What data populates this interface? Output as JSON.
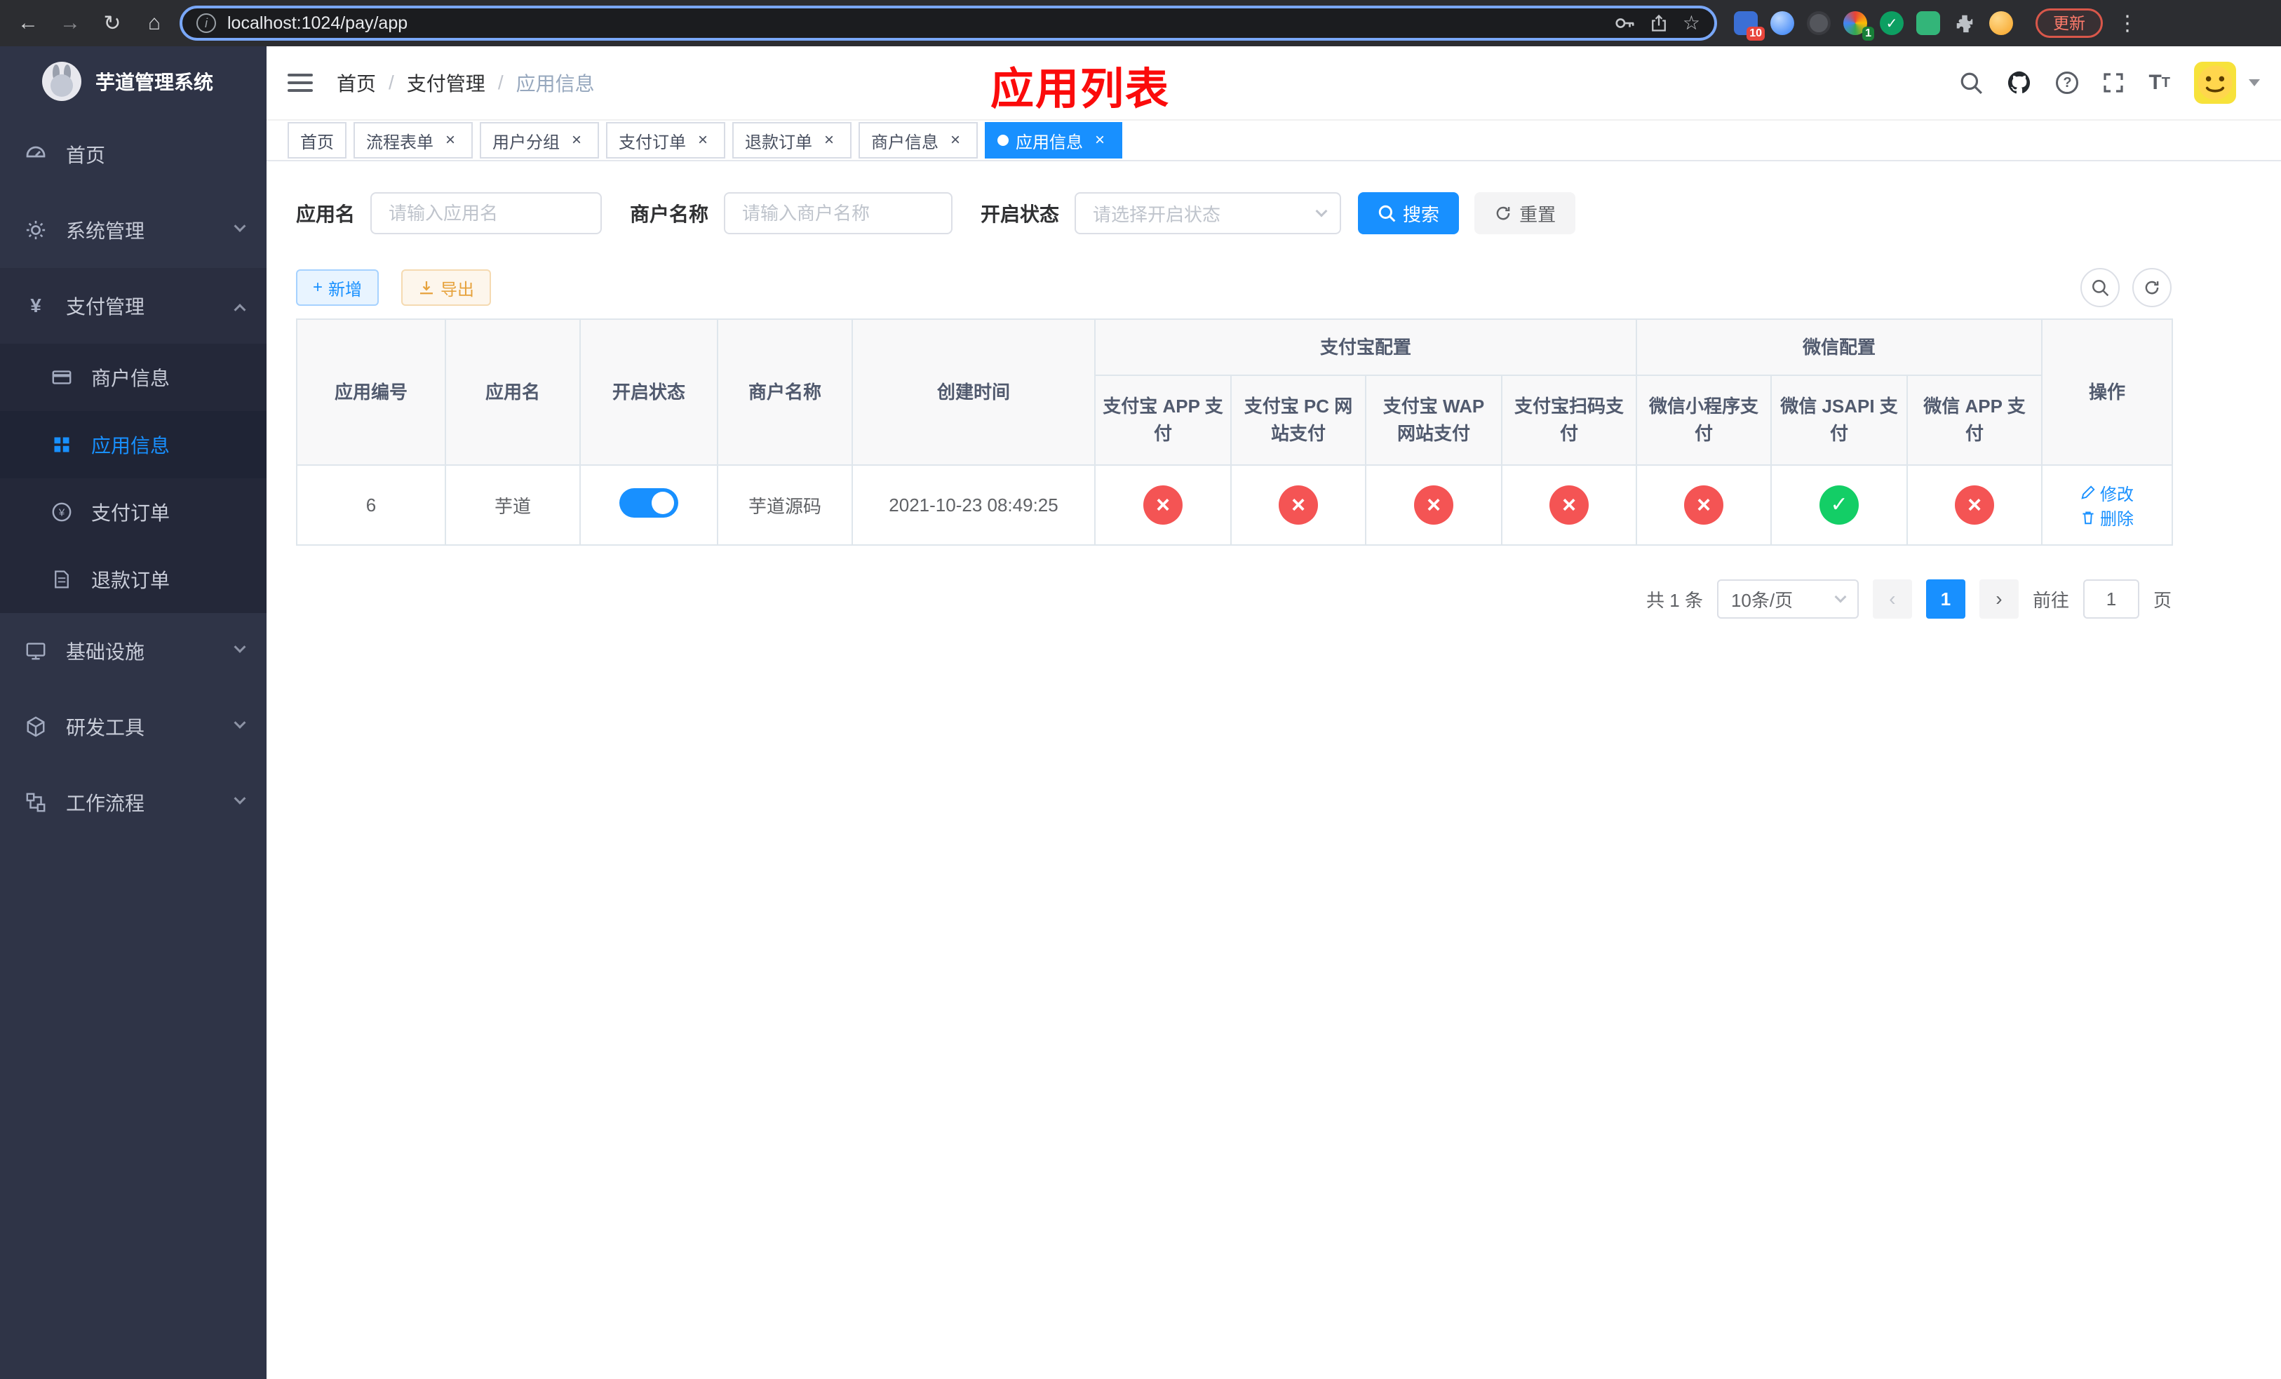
{
  "browser": {
    "url": "localhost:1024/pay/app",
    "update_button": "更新",
    "extension_badges": {
      "pinned_blue": "10",
      "pinned_colorful": "1"
    }
  },
  "sidebar": {
    "logo_title": "芋道管理系统",
    "items": [
      {
        "label": "首页"
      },
      {
        "label": "系统管理"
      },
      {
        "label": "支付管理"
      },
      {
        "label": "基础设施"
      },
      {
        "label": "研发工具"
      },
      {
        "label": "工作流程"
      }
    ],
    "payment_submenu": [
      {
        "label": "商户信息"
      },
      {
        "label": "应用信息"
      },
      {
        "label": "支付订单"
      },
      {
        "label": "退款订单"
      }
    ]
  },
  "navbar": {
    "breadcrumb": [
      "首页",
      "支付管理",
      "应用信息"
    ]
  },
  "annotation": {
    "title": "应用列表"
  },
  "tags": [
    {
      "label": "首页"
    },
    {
      "label": "流程表单"
    },
    {
      "label": "用户分组"
    },
    {
      "label": "支付订单"
    },
    {
      "label": "退款订单"
    },
    {
      "label": "商户信息"
    },
    {
      "label": "应用信息"
    }
  ],
  "filters": {
    "app_name_label": "应用名",
    "app_name_placeholder": "请输入应用名",
    "merchant_label": "商户名称",
    "merchant_placeholder": "请输入商户名称",
    "status_label": "开启状态",
    "status_placeholder": "请选择开启状态",
    "search_button": "搜索",
    "reset_button": "重置"
  },
  "toolbar": {
    "add_button": "新增",
    "export_button": "导出"
  },
  "table": {
    "col_app_id": "应用编号",
    "col_app_name": "应用名",
    "col_status": "开启状态",
    "col_merchant": "商户名称",
    "col_created": "创建时间",
    "group_alipay": "支付宝配置",
    "group_wechat": "微信配置",
    "col_alipay_app": "支付宝 APP 支付",
    "col_alipay_pc": "支付宝 PC 网站支付",
    "col_alipay_wap": "支付宝 WAP 网站支付",
    "col_alipay_qr": "支付宝扫码支付",
    "col_wx_mini": "微信小程序支付",
    "col_wx_jsapi": "微信 JSAPI 支付",
    "col_wx_app": "微信 APP 支付",
    "col_actions": "操作",
    "row": {
      "id": "6",
      "name": "芋道",
      "enabled": "on",
      "merchant": "芋道源码",
      "created": "2021-10-23 08:49:25",
      "statuses": [
        "cross",
        "cross",
        "cross",
        "cross",
        "cross",
        "check",
        "cross"
      ],
      "edit_label": "修改",
      "delete_label": "删除"
    }
  },
  "pagination": {
    "total": "共 1 条",
    "page_size": "10条/页",
    "current_page": "1",
    "goto_label": "前往",
    "goto_value": "1",
    "goto_unit": "页"
  },
  "colors": {
    "accent_blue": "#1890ff",
    "danger_red": "#f45454",
    "success_green": "#13ce66",
    "sidebar_bg": "#2f3447",
    "annotation_red": "#fb0b0b"
  }
}
